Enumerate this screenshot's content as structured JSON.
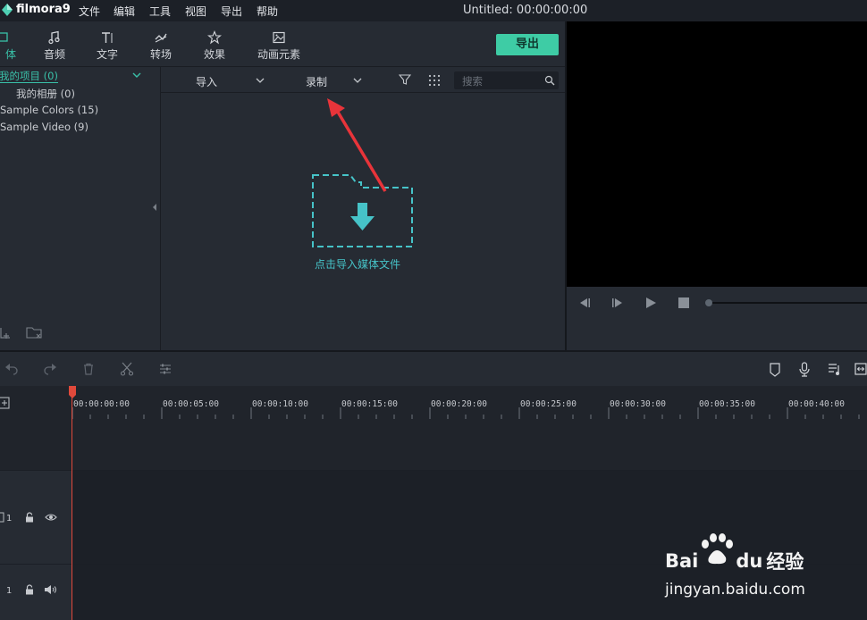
{
  "app": {
    "logo_text": "filmora9",
    "menu": [
      "文件",
      "编辑",
      "工具",
      "视图",
      "导出",
      "帮助"
    ],
    "title": "Untitled: 00:00:00:00"
  },
  "tabs": [
    {
      "label": "体",
      "icon": "media-icon",
      "active": true
    },
    {
      "label": "音频",
      "icon": "music-note-icon"
    },
    {
      "label": "文字",
      "icon": "text-icon"
    },
    {
      "label": "转场",
      "icon": "transition-icon"
    },
    {
      "label": "效果",
      "icon": "effects-icon"
    },
    {
      "label": "动画元素",
      "icon": "elements-image-icon"
    }
  ],
  "export_label": "导出",
  "tree": [
    {
      "label": "我的项目 (0)",
      "active": true
    },
    {
      "label": "我的相册 (0)"
    },
    {
      "label": "Sample Colors (15)"
    },
    {
      "label": "Sample Video (9)"
    }
  ],
  "toolbar": {
    "import_label": "导入",
    "record_label": "录制",
    "search_placeholder": "搜索"
  },
  "import_area_label": "点击导入媒体文件",
  "timeline": {
    "timecodes": [
      "00:00:00:00",
      "00:00:05:00",
      "00:00:10:00",
      "00:00:15:00",
      "00:00:20:00",
      "00:00:25:00",
      "00:00:30:00",
      "00:00:35:00",
      "00:00:40:00"
    ],
    "video_track_label": "1",
    "audio_track_label": "1"
  },
  "watermark": {
    "brand_left": "Bai",
    "brand_right": "du",
    "product": "经验",
    "url": "jingyan.baidu.com"
  },
  "colors": {
    "accent": "#3ecca5",
    "import_text": "#46c3c8",
    "playhead": "#e0493b",
    "annotation_arrow": "#e8343a"
  }
}
